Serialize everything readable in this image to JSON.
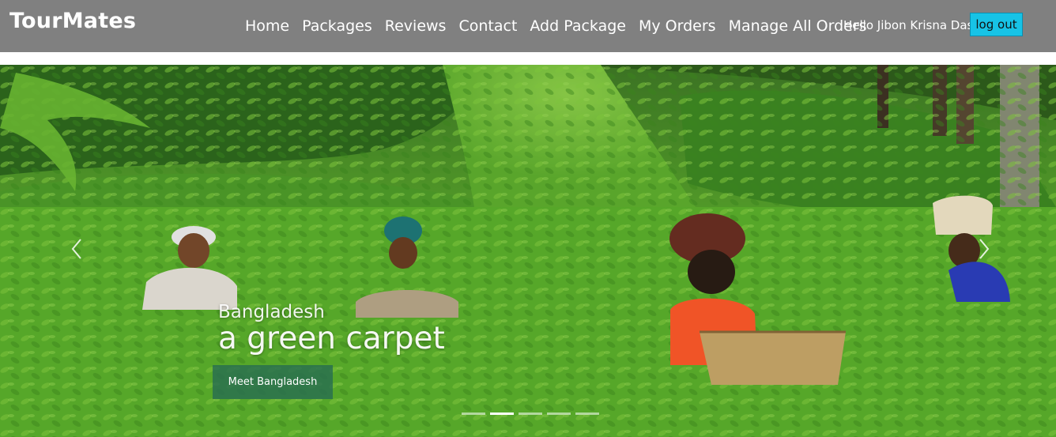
{
  "navbar": {
    "brand": "TourMates",
    "links": [
      {
        "label": "Home"
      },
      {
        "label": "Packages"
      },
      {
        "label": "Reviews"
      },
      {
        "label": "Contact"
      },
      {
        "label": "Add Package"
      },
      {
        "label": "My Orders"
      },
      {
        "label": "Manage All Orders"
      }
    ],
    "greeting": "Hello Jibon Krisna Das",
    "logout_label": "log out"
  },
  "hero": {
    "subtitle": "Bangladesh",
    "title": "a green carpet",
    "cta_label": "Meet Bangladesh",
    "slide_count": 5,
    "active_slide": 2
  },
  "colors": {
    "navbar_bg": "#808080",
    "logout_bg": "#17c3e6",
    "cta_bg": "#286e50",
    "tea_green": "#5fb82e"
  }
}
